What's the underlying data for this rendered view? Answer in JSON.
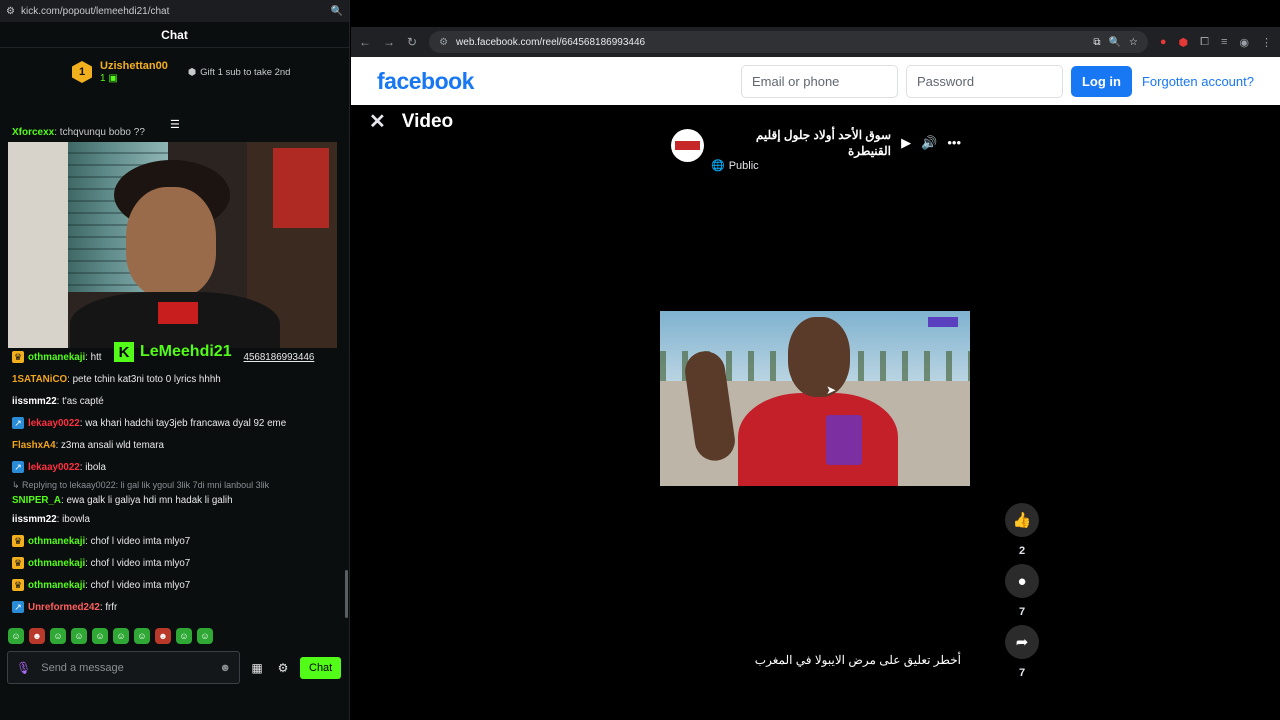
{
  "kick": {
    "url": "kick.com/popout/lemeehdi21/chat",
    "chat_title": "Chat",
    "top_gifter": {
      "rank": "1",
      "name": "Uzishettan00",
      "count": "1"
    },
    "gift_cta": "Gift 1 sub to take 2nd",
    "cutoff_message": {
      "user": "Xforcexx",
      "text": ": tchqvunqu bobo ??"
    },
    "streamer_name": "LeMeehdi21",
    "messages": [
      {
        "badge": "crown",
        "user": "othmanekaji",
        "color": "#53fc18",
        "text": ": htt",
        "link": "4568186993446"
      },
      {
        "badge": "",
        "user": "1SATANiCO",
        "color": "#f2a51e",
        "text": ": pete tchin kat3ni toto 0 lyrics hhhh"
      },
      {
        "badge": "",
        "user": "iissmm22",
        "color": "#ffffff",
        "text": ": t'as capté"
      },
      {
        "badge": "arrow",
        "user": "lekaay0022",
        "color": "#ff3040",
        "text": ": wa khari hadchi tay3jeb francawa dyal 92 eme"
      },
      {
        "badge": "",
        "user": "FlashxA4",
        "color": "#f2a51e",
        "text": ": z3ma ansali wld temara"
      },
      {
        "badge": "arrow",
        "user": "lekaay0022",
        "color": "#ff3040",
        "text": ": ibola"
      },
      {
        "reply": "Replying to lekaay0022: li gal lik ygoul 3lik 7di mni lanboul 3lik",
        "badge": "",
        "user": "SNIPER_A",
        "color": "#53fc18",
        "text": ": ewa galk li galiya hdi mn hadak li galih"
      },
      {
        "badge": "",
        "user": "iissmm22",
        "color": "#ffffff",
        "text": ": ibowla"
      },
      {
        "badge": "crown",
        "user": "othmanekaji",
        "color": "#53fc18",
        "text": ": chof l video imta mlyo7"
      },
      {
        "badge": "crown",
        "user": "othmanekaji",
        "color": "#53fc18",
        "text": ": chof l video imta mlyo7"
      },
      {
        "badge": "crown",
        "user": "othmanekaji",
        "color": "#53fc18",
        "text": ": chof l video imta mlyo7"
      },
      {
        "badge": "arrow",
        "user": "Unreformed242",
        "color": "#ff5e5e",
        "text": ": frfr"
      }
    ],
    "input_placeholder": "Send a message",
    "chat_button": "Chat",
    "accent": "#53fc18"
  },
  "browser": {
    "url": "web.facebook.com/reel/664568186993446"
  },
  "facebook": {
    "logo": "facebook",
    "email_placeholder": "Email or phone",
    "password_placeholder": "Password",
    "login_button": "Log in",
    "forgot_link": "Forgotten account?",
    "video_heading": "Video",
    "reel_title": "سوق الأحد أولاد جلول إقليم القنيطرة",
    "visibility": "Public",
    "likes": "2",
    "comments": "7",
    "shares": "7",
    "caption": "أخطر تعليق على مرض الايبولا في المغرب",
    "brand_color": "#1877f2"
  }
}
